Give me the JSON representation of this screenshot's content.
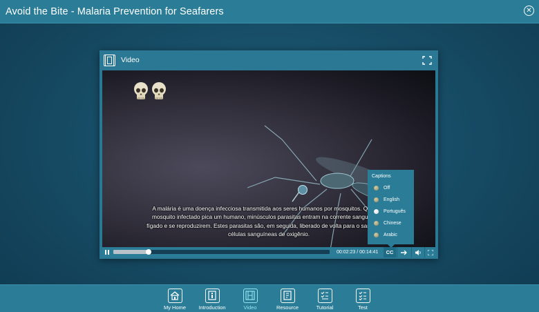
{
  "app": {
    "title": "Avoid the Bite - Malaria Prevention for Seafarers",
    "close_icon": "close-circle-icon"
  },
  "panel": {
    "title": "Video",
    "icon": "film-icon",
    "fullscreen_icon": "expand-icon"
  },
  "subtitle": {
    "line1": "A malária é uma doença infecciosa transmitida aos seres humanos por mosquitos. Quan           do",
    "line2": "mosquito infectado pica um humano, minúsculos parasitas entram na corrente sanguíne           a o",
    "line3": "fígado e se reproduzirem. Estes parasitas são, em seguida, liberado de volta para o sangu          ar as",
    "line4": "células sanguíneas de oxigênio."
  },
  "captions": {
    "title": "Captions",
    "options": [
      {
        "label": "Off",
        "selected": false
      },
      {
        "label": "English",
        "selected": false
      },
      {
        "label": "Português",
        "selected": true
      },
      {
        "label": "Chinese",
        "selected": false
      },
      {
        "label": "Arabic",
        "selected": false
      }
    ]
  },
  "player": {
    "time": "00:02:23 / 00:14:41",
    "progress": 0.162,
    "cc_label": "CC",
    "icons": [
      "pause-icon",
      "cc-icon",
      "next-arrow-icon",
      "volume-icon",
      "fullscreen-icon"
    ]
  },
  "nav": {
    "items": [
      {
        "label": "My Home",
        "icon": "home-icon",
        "active": false
      },
      {
        "label": "Introduction",
        "icon": "info-icon",
        "active": false
      },
      {
        "label": "Video",
        "icon": "film-icon",
        "active": true
      },
      {
        "label": "Resource",
        "icon": "document-icon",
        "active": false
      },
      {
        "label": "Tutorial",
        "icon": "checklist-icon",
        "active": false
      },
      {
        "label": "Test",
        "icon": "test-icon",
        "active": false
      }
    ]
  },
  "colors": {
    "bar": "#2b7d97",
    "accent": "#8fe6f2",
    "background": "#164a63"
  }
}
